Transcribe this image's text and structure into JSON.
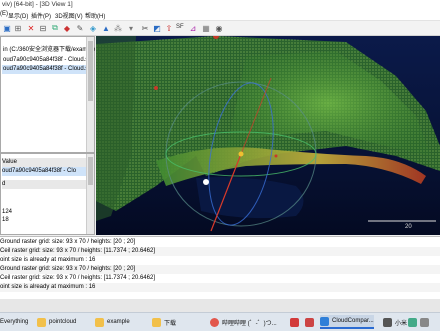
{
  "window": {
    "title": "viv) [64-bit] - [3D View 1]"
  },
  "menu": {
    "items": [
      "(E)",
      "显示(D)",
      "插件(P)",
      "3D视图(V)",
      "帮助(H)"
    ]
  },
  "toolbar": {
    "icons": [
      "save-icon",
      "open-icon",
      "close-icon",
      "delete-icon",
      "clone-icon",
      "cloud-icon",
      "tool-icon",
      "octree-icon",
      "mesh-icon",
      "sample-icon",
      "filter-icon",
      "segment-icon",
      "plane-icon",
      "normals-icon",
      "distance-icon",
      "sf-icon"
    ],
    "sf_label": "SF"
  },
  "db_tree": {
    "items": [
      "in (C:/360安全浏览器下载/example",
      "oud7a90c9405a84f38f - Cloud.s...",
      "oud7a90c9405a84f38f - Cloud.s..."
    ]
  },
  "properties": {
    "header": "Value",
    "rows": [
      "oud7a90c9405a84f38f - Clo",
      "d",
      "",
      "",
      "124",
      "18"
    ]
  },
  "view": {
    "scale_label": "20"
  },
  "console": {
    "lines": [
      "Ground raster grid: size: 93 x 70 / heights: [20 ; 20]",
      "Ceil raster grid: size: 93 x 70 / heights: [11.7374 ; 20.6462]",
      "oint size is already at maximum : 16",
      "Ground raster grid: size: 93 x 70 / heights: [20 ; 20]",
      "Ceil raster grid: size: 93 x 70 / heights: [11.7374 ; 20.6462]",
      "oint size is already at maximum : 16"
    ]
  },
  "taskbar": {
    "items": [
      "Everything",
      "pointcloud",
      "example",
      "下载",
      "哔哩哔哩 (゜-゜)つ...",
      "CloudCompar...",
      "小米"
    ],
    "colors": {
      "everything": "#e08a1a",
      "pointcloud": "#f2c04a",
      "example": "#f2c04a",
      "download": "#f2c04a",
      "bilibili": "#e2574c",
      "cloudcompare": "#2f7fd8"
    }
  }
}
